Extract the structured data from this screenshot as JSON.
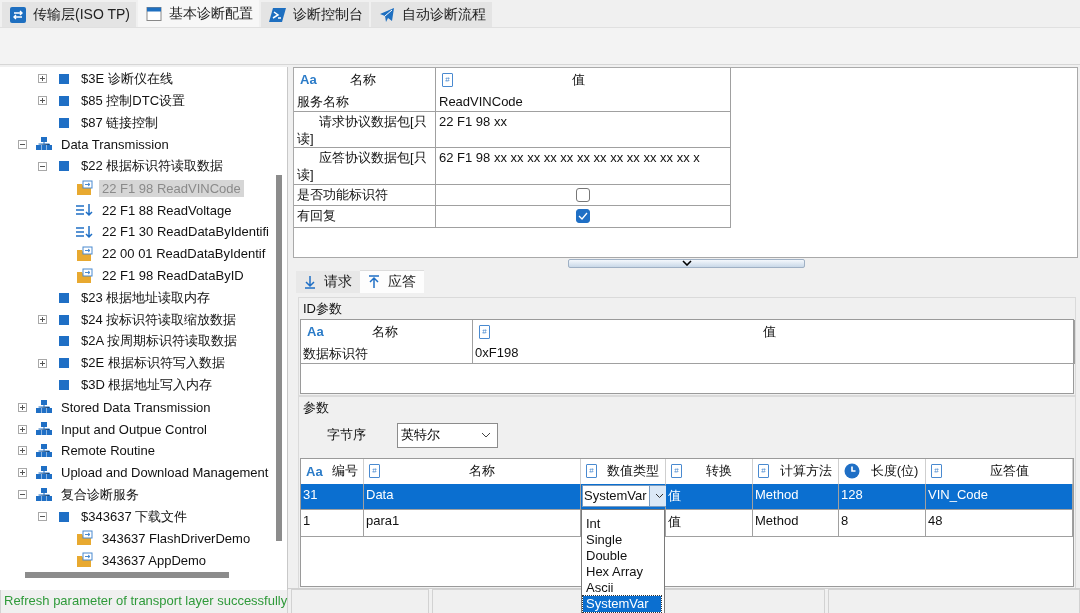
{
  "tabs": [
    {
      "label": "传输层(ISO TP)",
      "kind": "transfer",
      "selected": false
    },
    {
      "label": "基本诊断配置",
      "kind": "window",
      "selected": true
    },
    {
      "label": "诊断控制台",
      "kind": "console",
      "selected": false
    },
    {
      "label": "自动诊断流程",
      "kind": "send",
      "selected": false
    }
  ],
  "tree": {
    "items": [
      {
        "children": [
          {
            "label": "$3E 诊断仪在线",
            "kind": "service",
            "expanded": false,
            "selected": false
          },
          {
            "label": "$85 控制DTC设置",
            "kind": "service",
            "expanded": false,
            "selected": false
          },
          {
            "label": "$87 链接控制",
            "kind": "service",
            "selected": false
          }
        ]
      },
      {
        "label": "Data Transmission",
        "kind": "group",
        "expanded": true,
        "selected": false,
        "children": [
          {
            "label": "$22 根据标识符读取数据",
            "kind": "service",
            "expanded": true,
            "selected": false,
            "children": [
              {
                "label": "22 F1 98 ReadVINCode",
                "kind": "request",
                "selected": true
              },
              {
                "label": "22 F1 88 ReadVoltage",
                "kind": "list",
                "selected": false
              },
              {
                "label": "22 F1 30 ReadDataByIdentifi",
                "kind": "list",
                "selected": false
              },
              {
                "label": "22 00 01 ReadDataByIdentif",
                "kind": "request",
                "selected": false
              },
              {
                "label": "22 F1 98 ReadDataByID",
                "kind": "request",
                "selected": false
              }
            ]
          },
          {
            "label": "$23 根据地址读取内存",
            "kind": "service",
            "selected": false
          },
          {
            "label": "$24 按标识符读取缩放数据",
            "kind": "service",
            "expanded": false,
            "selected": false
          },
          {
            "label": "$2A 按周期标识符读取数据",
            "kind": "service",
            "selected": false
          },
          {
            "label": "$2E 根据标识符写入数据",
            "kind": "service",
            "expanded": false,
            "selected": false
          },
          {
            "label": "$3D 根据地址写入内存",
            "kind": "service",
            "selected": false
          }
        ]
      },
      {
        "label": "Stored Data Transmission",
        "kind": "group",
        "expanded": false,
        "selected": false
      },
      {
        "label": "Input and Outpue Control",
        "kind": "group",
        "expanded": false,
        "selected": false
      },
      {
        "label": "Remote Routine",
        "kind": "group",
        "expanded": false,
        "selected": false
      },
      {
        "label": "Upload and Download Management",
        "kind": "group",
        "expanded": false,
        "selected": false
      },
      {
        "label": "复合诊断服务",
        "kind": "group",
        "expanded": true,
        "selected": false,
        "children": [
          {
            "label": "$343637 下载文件",
            "kind": "service",
            "expanded": true,
            "selected": false,
            "children": [
              {
                "label": "343637 FlashDriverDemo",
                "kind": "request",
                "selected": false
              },
              {
                "label": "343637 AppDemo",
                "kind": "request",
                "selected": false
              }
            ]
          }
        ]
      }
    ]
  },
  "properties": {
    "columns": [
      {
        "kind": "text",
        "icon": "Aa",
        "label": "名称"
      },
      {
        "kind": "number",
        "icon": "#",
        "label": "值"
      }
    ],
    "rows": [
      {
        "kind": "text",
        "name": "服务名称",
        "value": "ReadVINCode"
      },
      {
        "kind": "text",
        "name": "请求协议数据包[只读]",
        "value": "22 F1 98 xx"
      },
      {
        "kind": "text",
        "name": "应答协议数据包[只读]",
        "value": "62 F1 98 xx xx xx xx xx xx xx xx xx xx xx xx x"
      },
      {
        "kind": "checkbox",
        "name": "是否功能标识符",
        "checked": false
      },
      {
        "kind": "checkbox",
        "name": "有回复",
        "checked": true
      }
    ]
  },
  "subtabs": [
    {
      "label": "请求",
      "kind": "down",
      "selected": false
    },
    {
      "label": "应答",
      "kind": "up",
      "selected": true
    }
  ],
  "id_params": {
    "title": "ID参数",
    "columns": [
      {
        "kind": "text",
        "icon": "Aa",
        "label": "名称"
      },
      {
        "kind": "number",
        "icon": "#",
        "label": "值"
      }
    ],
    "rows": [
      {
        "name": "数据标识符",
        "value": "0xF198"
      }
    ]
  },
  "params": {
    "title": "参数",
    "byte_order": {
      "label": "字节序",
      "value": "英特尔"
    },
    "columns": [
      {
        "kind": "text",
        "icon": "Aa",
        "label": "编号"
      },
      {
        "kind": "number",
        "icon": "#",
        "label": "名称"
      },
      {
        "kind": "number",
        "icon": "#",
        "label": "数值类型"
      },
      {
        "kind": "number",
        "icon": "#",
        "label": "转换"
      },
      {
        "kind": "number",
        "icon": "#",
        "label": "计算方法"
      },
      {
        "kind": "time",
        "label": "长度(位)"
      },
      {
        "kind": "number",
        "icon": "#",
        "label": "应答值"
      }
    ],
    "rows": [
      {
        "selected": true,
        "cells": [
          "31",
          "Data",
          "SystemVar",
          "值",
          "Method",
          "128",
          "VIN_Code"
        ]
      },
      {
        "selected": false,
        "cells": [
          "1",
          "para1",
          null,
          "值",
          "Method",
          "8",
          "48"
        ]
      }
    ],
    "dropdown": {
      "options": [
        {
          "label": "Int",
          "selected": false
        },
        {
          "label": "Single",
          "selected": false
        },
        {
          "label": "Double",
          "selected": false
        },
        {
          "label": "Hex Array",
          "selected": false
        },
        {
          "label": "Ascii",
          "selected": false
        },
        {
          "label": "SystemVar",
          "selected": true
        }
      ]
    }
  },
  "status_bar": {
    "message": "Refresh parameter of transport layer successfully"
  }
}
